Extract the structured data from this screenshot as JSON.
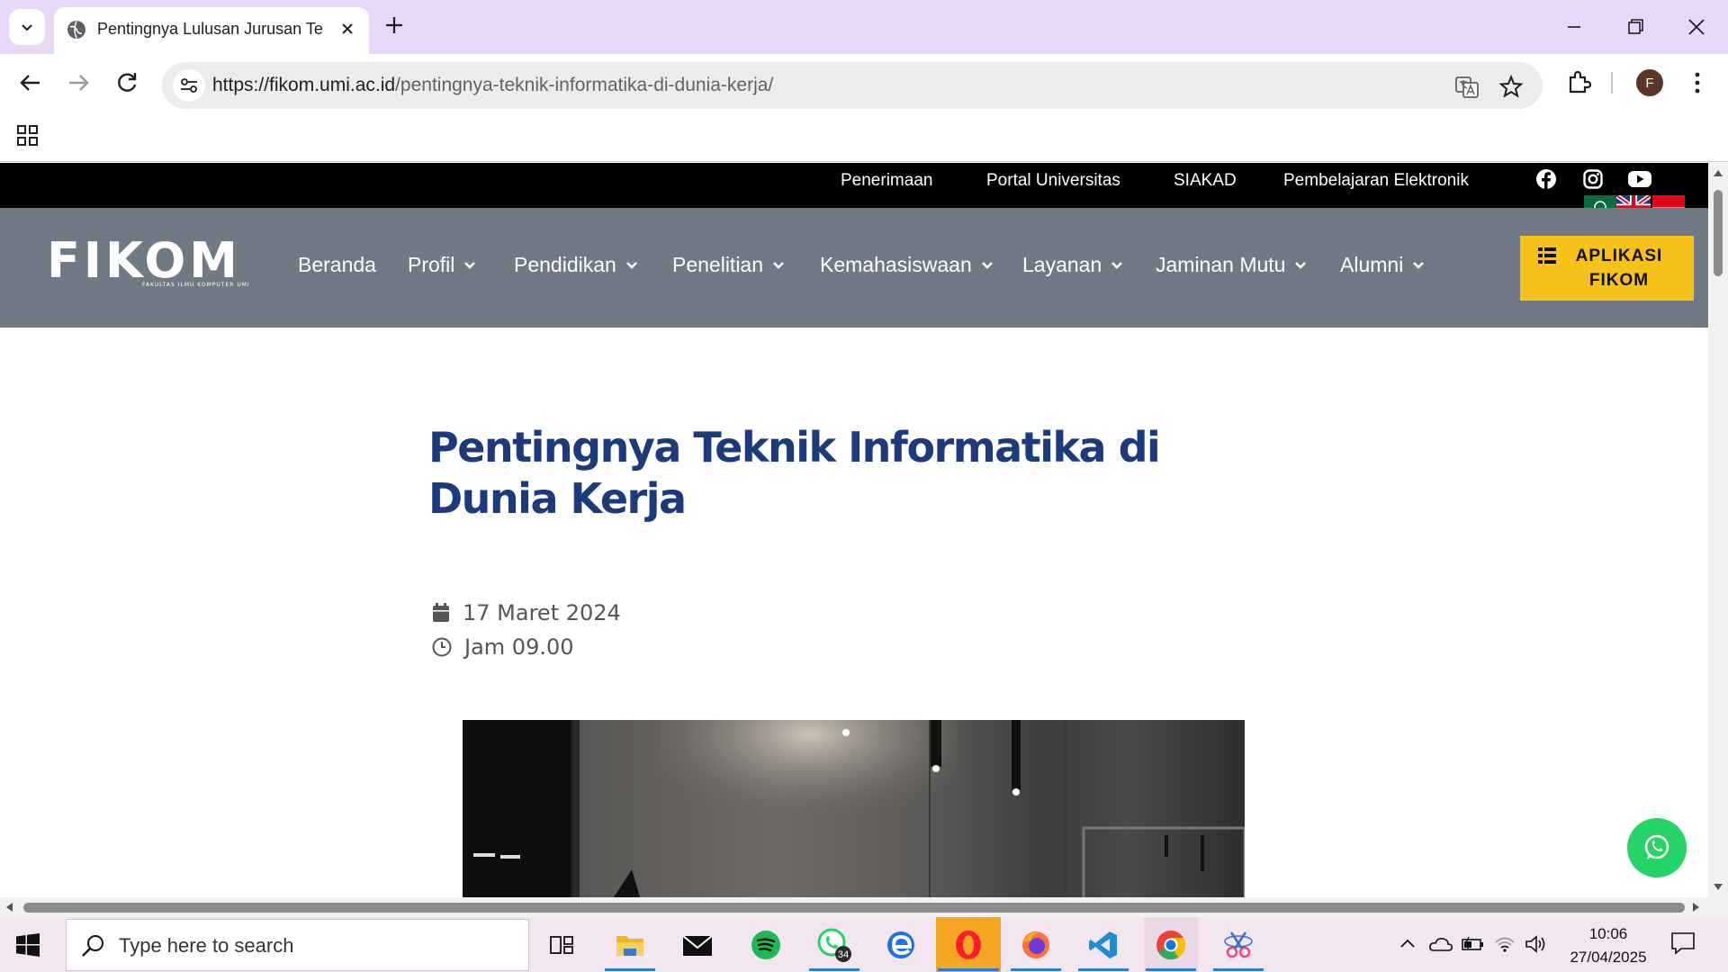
{
  "browser": {
    "tab_title": "Pentingnya Lulusan Jurusan Teknik Informatika",
    "url_host": "https://fikom.umi.ac.id",
    "url_path": "/pentingnya-teknik-informatika-di-dunia-kerja/",
    "profile_initial": "F"
  },
  "site": {
    "top_links": [
      "Penerimaan",
      "Portal Universitas",
      "SIAKAD",
      "Pembelajaran Elektronik"
    ],
    "logo_text": "FIKOM",
    "logo_subtext": "FAKULTAS ILMU KOMPUTER UMI",
    "menu": [
      "Beranda",
      "Profil",
      "Pendidikan",
      "Penelitian",
      "Kemahasiswaan",
      "Layanan",
      "Jaminan Mutu",
      "Alumni"
    ],
    "app_button": "APLIKASI FIKOM"
  },
  "article": {
    "title": "Pentingnya Teknik Informatika di Dunia Kerja",
    "date": "17 Maret 2024",
    "time": "Jam 09.00"
  },
  "taskbar": {
    "search_placeholder": "Type here to search",
    "whatsapp_badge": "34",
    "time": "10:06",
    "date": "27/04/2025"
  },
  "colors": {
    "title_blue": "#1c3b7c",
    "nav_gray": "#6f7a84",
    "app_yellow": "#f6c11b",
    "whatsapp_green": "#25d366"
  }
}
